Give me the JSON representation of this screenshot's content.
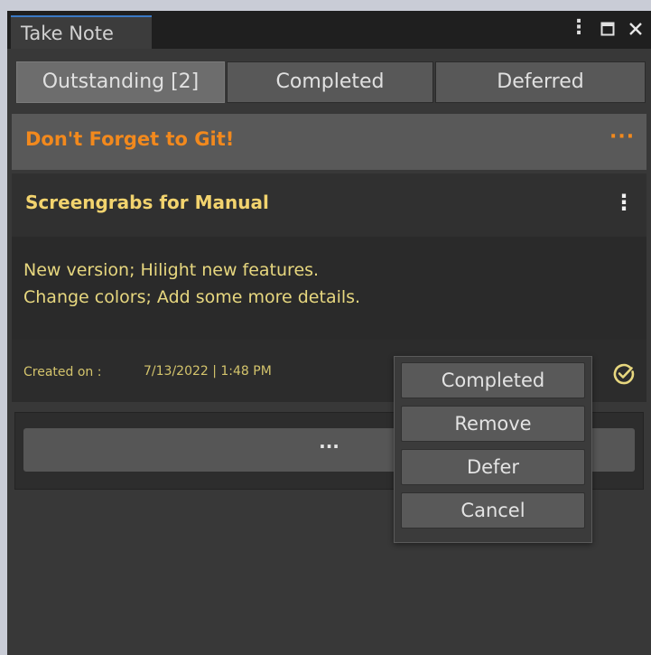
{
  "window": {
    "title": "Take Note"
  },
  "tabs": [
    {
      "label": "Outstanding [2]",
      "active": true
    },
    {
      "label": "Completed",
      "active": false
    },
    {
      "label": "Deferred",
      "active": false
    }
  ],
  "note_header": {
    "title": "Don't Forget to Git!",
    "more_glyph": "···",
    "color": "#f2891d"
  },
  "card": {
    "title": "Screengrabs for Manual",
    "kebab_glyph": "⋮",
    "body_lines": [
      "New version; Hilight new features.",
      "Change colors; Add some more details."
    ],
    "created_label": "Created on :",
    "created_value": "7/13/2022 | 1:48 PM",
    "text_color": "#e7d77f"
  },
  "more_button": {
    "label": "···"
  },
  "context_menu": {
    "items": [
      {
        "label": "Completed"
      },
      {
        "label": "Remove"
      },
      {
        "label": "Defer"
      },
      {
        "label": "Cancel"
      }
    ]
  },
  "icons": {
    "window_menu": "kebab-icon",
    "maximize": "maximize-icon",
    "close": "close-icon",
    "complete": "check-circle-icon"
  }
}
